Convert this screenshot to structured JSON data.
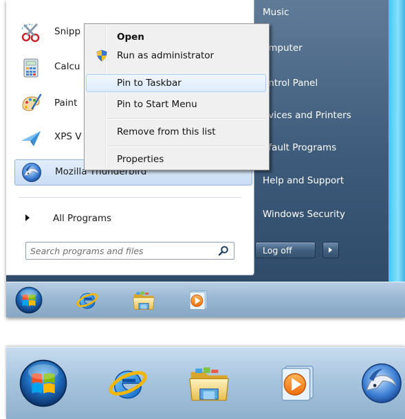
{
  "start_menu": {
    "programs": [
      {
        "label": "Snipp",
        "icon": "snipping-tool-icon"
      },
      {
        "label": "Calcu",
        "icon": "calculator-icon"
      },
      {
        "label": "Paint",
        "icon": "paint-icon"
      },
      {
        "label": "XPS V",
        "icon": "xps-viewer-icon"
      },
      {
        "label": "Mozilla Thunderbird",
        "icon": "thunderbird-icon"
      }
    ],
    "all_programs": "All Programs",
    "search": {
      "placeholder": "Search programs and files"
    },
    "right_items": [
      "Music",
      "omputer",
      "ontrol Panel",
      "evices and Printers",
      "efault Programs",
      "Help and Support",
      "Windows Security"
    ],
    "logoff_label": "Log off"
  },
  "context_menu": {
    "items": [
      {
        "label": "Open",
        "bold": true
      },
      {
        "label": "Run as administrator",
        "icon": "uac-shield-icon"
      },
      {
        "label": "Pin to Taskbar",
        "highlighted": true
      },
      {
        "label": "Pin to Start Menu"
      },
      {
        "label": "Remove from this list"
      },
      {
        "label": "Properties"
      }
    ]
  },
  "taskbar_icons": [
    "start-orb-icon",
    "internet-explorer-icon",
    "windows-explorer-icon",
    "media-player-icon"
  ],
  "taskbar_icons_after_pin": [
    "start-orb-icon",
    "internet-explorer-icon",
    "windows-explorer-icon",
    "media-player-icon",
    "thunderbird-icon"
  ],
  "colors": {
    "desktop": "#1283c8",
    "start_right_pane": "#3e5b7b",
    "highlight": "#c9ddf5",
    "taskbar": "#9ab8d3"
  }
}
